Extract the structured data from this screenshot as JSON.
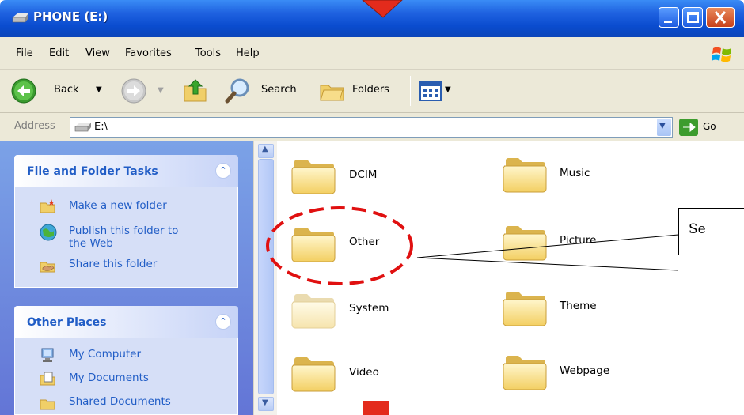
{
  "window": {
    "title": "PHONE (E:)",
    "buttons": [
      "minimize",
      "maximize",
      "close"
    ]
  },
  "menu": {
    "items": [
      "File",
      "Edit",
      "View",
      "Favorites",
      "Tools",
      "Help"
    ]
  },
  "toolbar": {
    "back_label": "Back",
    "search_label": "Search",
    "folders_label": "Folders"
  },
  "address": {
    "label": "Address",
    "value": "E:\\",
    "go_label": "Go"
  },
  "task_pane": {
    "file_folder_tasks": {
      "title": "File and Folder Tasks",
      "items": [
        "Make a new folder",
        "Publish this folder to",
        "the Web",
        "Share this folder"
      ]
    },
    "other_places": {
      "title": "Other Places",
      "items": [
        "My Computer",
        "My Documents",
        "Shared Documents"
      ]
    }
  },
  "folders": [
    "DCIM",
    "Music",
    "Other",
    "Picture",
    "System",
    "Theme",
    "Video",
    "Webpage"
  ],
  "annotation": {
    "callout_text": "Se",
    "color_circle": "#e01010",
    "color_arrow": "#e32b1c"
  },
  "icons": {
    "title_icon": "drive-icon",
    "back": "back-arrow-icon",
    "forward": "forward-arrow-icon",
    "up": "up-folder-icon",
    "search": "search-icon",
    "folders": "folders-icon",
    "views": "views-icon",
    "go": "go-arrow-icon"
  }
}
